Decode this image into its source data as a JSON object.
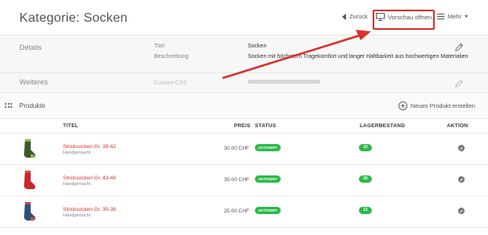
{
  "header": {
    "title": "Kategorie: Socken",
    "back_label": "Zurück",
    "preview_label": "Vorschau öffnen",
    "more_label": "Mehr"
  },
  "details": {
    "section_title": "Details",
    "fields": [
      {
        "label": "Titel",
        "value": "Socken"
      },
      {
        "label": "Beschreibung",
        "value": "Socken mit höchstem Tragekomfort und langer Haltbarkeit aus hochwertigen Materialien"
      }
    ]
  },
  "weiteres": {
    "section_title": "Weiteres",
    "field_label": "Custom CSS"
  },
  "products": {
    "section_title": "Produkte",
    "new_product_label": "Neues Produkt erstellen",
    "columns": {
      "title": "TITEL",
      "price": "PREIS",
      "status": "STATUS",
      "stock": "LAGERBESTAND",
      "action": "AKTION"
    },
    "rows": [
      {
        "name": "Stricksocken Gr. 39-42",
        "sub": "Handgemacht",
        "price": "30.00 CHF",
        "status": "AKTIVIERT",
        "stock": "10",
        "sock_color": "#3a5a2a",
        "sock_accent": "#7fbf3f"
      },
      {
        "name": "Stricksocken Gr. 43-46",
        "sub": "Handgemacht",
        "price": "35.00 CHF",
        "status": "AKTIVIERT",
        "stock": "30",
        "sock_color": "#c8262a",
        "sock_accent": "#e04a40"
      },
      {
        "name": "Stricksocken Gr. 35-38",
        "sub": "Handgemacht",
        "price": "25.00 CHF",
        "status": "AKTIVIERT",
        "stock": "12",
        "sock_color": "#2d4f7a",
        "sock_accent": "#d04a3a"
      }
    ]
  },
  "colors": {
    "accent_red": "#d9302a",
    "status_green": "#2eb84b"
  }
}
